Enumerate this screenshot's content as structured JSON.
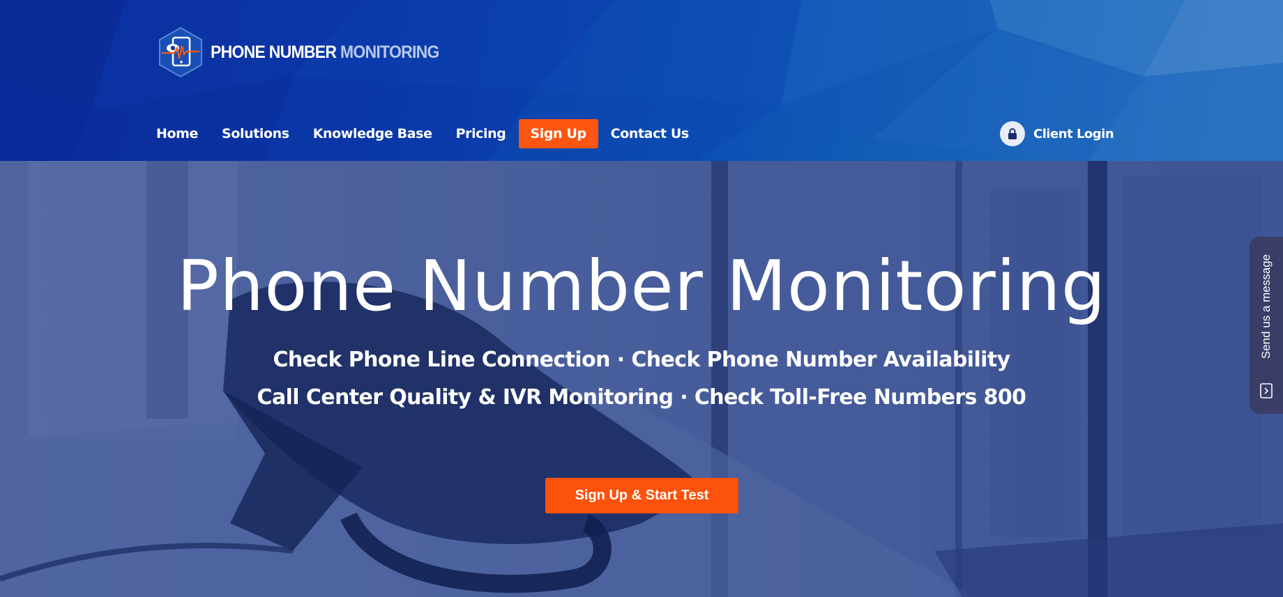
{
  "brand": {
    "name_primary": "PHONE NUMBER",
    "name_accent": "MONITORING",
    "logo_icon": "phone-eye-pulse-icon",
    "colors": {
      "accent_orange": "#fc5610",
      "header_blue": "#0a36a8",
      "logo_accent": "#b8c9ee"
    }
  },
  "nav": {
    "items": [
      {
        "label": "Home"
      },
      {
        "label": "Solutions"
      },
      {
        "label": "Knowledge Base"
      },
      {
        "label": "Pricing"
      },
      {
        "label": "Sign Up",
        "highlighted": true
      },
      {
        "label": "Contact Us"
      }
    ],
    "client_login": {
      "label": "Client Login",
      "icon": "lock-icon"
    }
  },
  "hero": {
    "title": "Phone Number Monitoring",
    "subtitle_line1": "Check Phone Line Connection · Check Phone Number Availability",
    "subtitle_line2": "Call Center Quality & IVR Monitoring · Check Toll-Free Numbers 800",
    "cta_label": "Sign Up & Start Test"
  },
  "feedback": {
    "label": "Send us a message",
    "icon": "chevron-box-icon"
  }
}
